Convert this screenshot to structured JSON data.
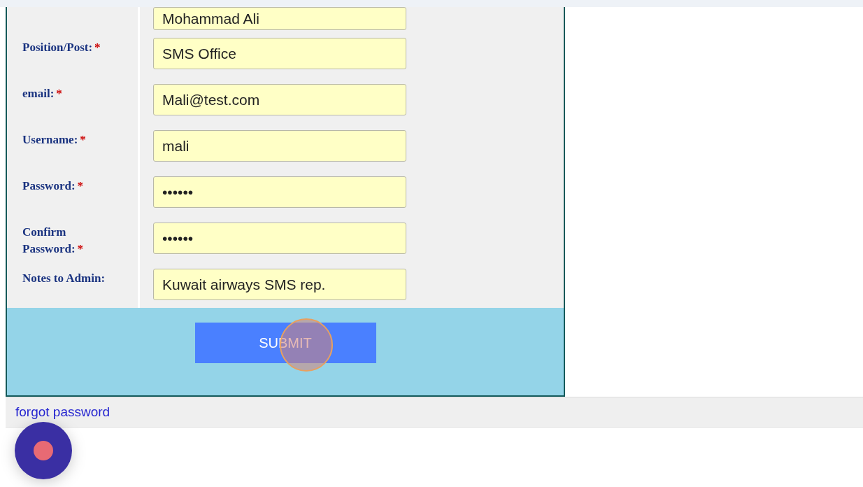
{
  "form": {
    "fields": [
      {
        "value": "Mohammad Ali"
      },
      {
        "label": "Position/Post:",
        "mark": "*",
        "value": "SMS Office"
      },
      {
        "label": "email:",
        "mark": "*",
        "value": "Mali@test.com"
      },
      {
        "label": "Username:",
        "mark": "*",
        "value": "mali"
      },
      {
        "label": "Password:",
        "mark": "*",
        "value": "••••••"
      },
      {
        "label": "Confirm Password:",
        "mark": "*",
        "value": "••••••"
      },
      {
        "label": "Notes to Admin:",
        "value": "Kuwait airways SMS rep."
      }
    ],
    "submit": "SUBMIT"
  },
  "footer": {
    "link": "forgot password"
  }
}
